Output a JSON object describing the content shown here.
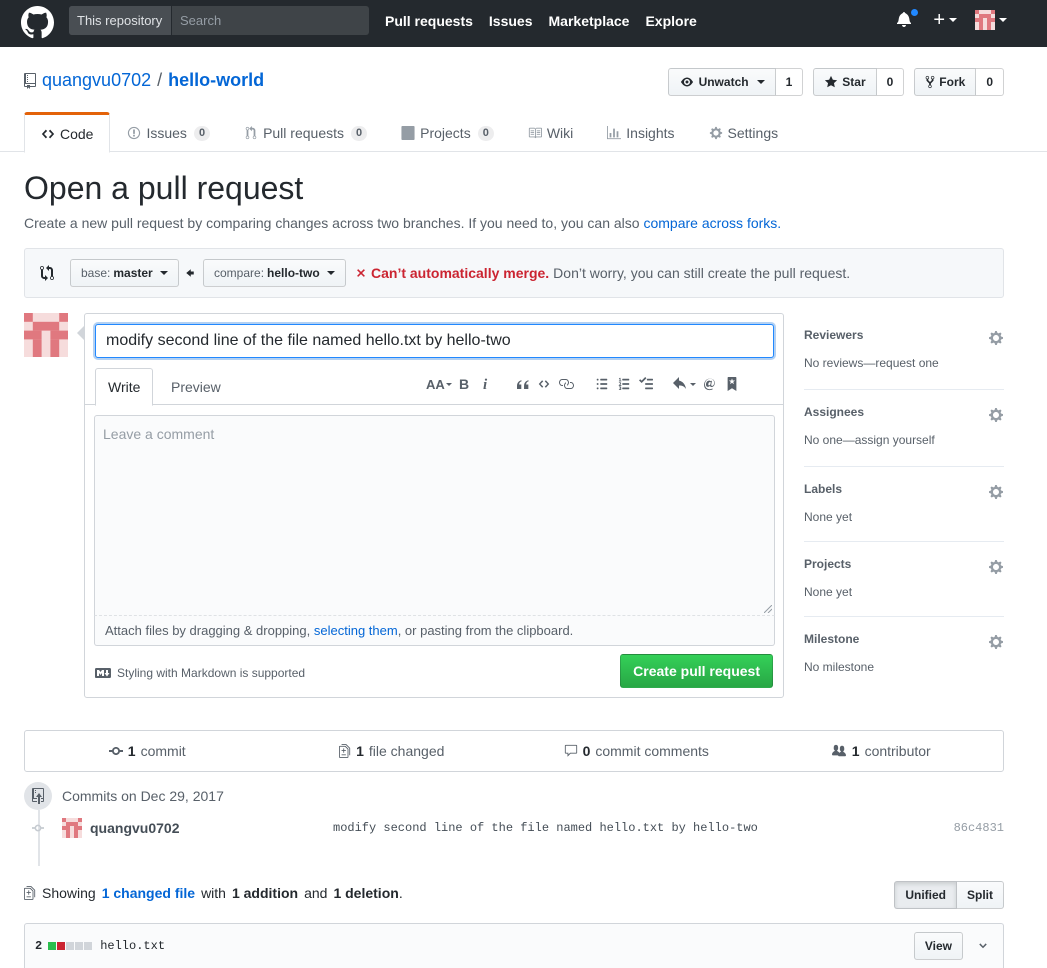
{
  "header": {
    "search_scope": "This repository",
    "search_placeholder": "Search",
    "nav": [
      "Pull requests",
      "Issues",
      "Marketplace",
      "Explore"
    ]
  },
  "repo": {
    "owner": "quangvu0702",
    "separator": "/",
    "name": "hello-world",
    "unwatch_label": "Unwatch",
    "unwatch_count": "1",
    "star_label": "Star",
    "star_count": "0",
    "fork_label": "Fork",
    "fork_count": "0"
  },
  "tabs": {
    "code": "Code",
    "issues": "Issues",
    "issues_count": "0",
    "pulls": "Pull requests",
    "pulls_count": "0",
    "projects": "Projects",
    "projects_count": "0",
    "wiki": "Wiki",
    "insights": "Insights",
    "settings": "Settings"
  },
  "page": {
    "title": "Open a pull request",
    "subtitle": "Create a new pull request by comparing changes across two branches. If you need to, you can also",
    "subtitle_link": "compare across forks."
  },
  "compare": {
    "base_prefix": "base:",
    "base_branch": "master",
    "compare_prefix": "compare:",
    "compare_branch": "hello-two",
    "merge_status": "Can’t automatically merge.",
    "merge_note": "Don’t worry, you can still create the pull request."
  },
  "form": {
    "title_value": "modify second line of the file named hello.txt by hello-two",
    "tab_write": "Write",
    "tab_preview": "Preview",
    "comment_placeholder": "Leave a comment",
    "attach_prefix": "Attach files by dragging & dropping,",
    "attach_link": "selecting them",
    "attach_suffix": ", or pasting from the clipboard.",
    "markdown_note": "Styling with Markdown is supported",
    "submit_label": "Create pull request"
  },
  "sidebar": {
    "reviewers": {
      "heading": "Reviewers",
      "value": "No reviews—request one"
    },
    "assignees": {
      "heading": "Assignees",
      "value": "No one—assign yourself"
    },
    "labels": {
      "heading": "Labels",
      "value": "None yet"
    },
    "projects": {
      "heading": "Projects",
      "value": "None yet"
    },
    "milestone": {
      "heading": "Milestone",
      "value": "No milestone"
    }
  },
  "summary": {
    "commits_num": "1",
    "commits_label": "commit",
    "files_num": "1",
    "files_label": "file changed",
    "comments_num": "0",
    "comments_label": "commit comments",
    "contributors_num": "1",
    "contributors_label": "contributor"
  },
  "commits": {
    "heading": "Commits on Dec 29, 2017",
    "items": [
      {
        "author": "quangvu0702",
        "message": "modify second line of the file named hello.txt by hello-two",
        "sha": "86c4831"
      }
    ]
  },
  "files": {
    "showing": "Showing",
    "changed_link": "1 changed file",
    "with": "with",
    "additions": "1 addition",
    "and": "and",
    "deletions": "1 deletion",
    "period": ".",
    "unified_label": "Unified",
    "split_label": "Split",
    "diffstat_total": "2",
    "file_name": "hello.txt",
    "view_label": "View"
  },
  "colors": {
    "header_bg": "#24292e",
    "link": "#0366d6",
    "accent_tab": "#e36209",
    "error": "#cb2431",
    "primary_btn": "#28a745",
    "addition": "#2cbe4e",
    "deletion": "#cb2431"
  }
}
